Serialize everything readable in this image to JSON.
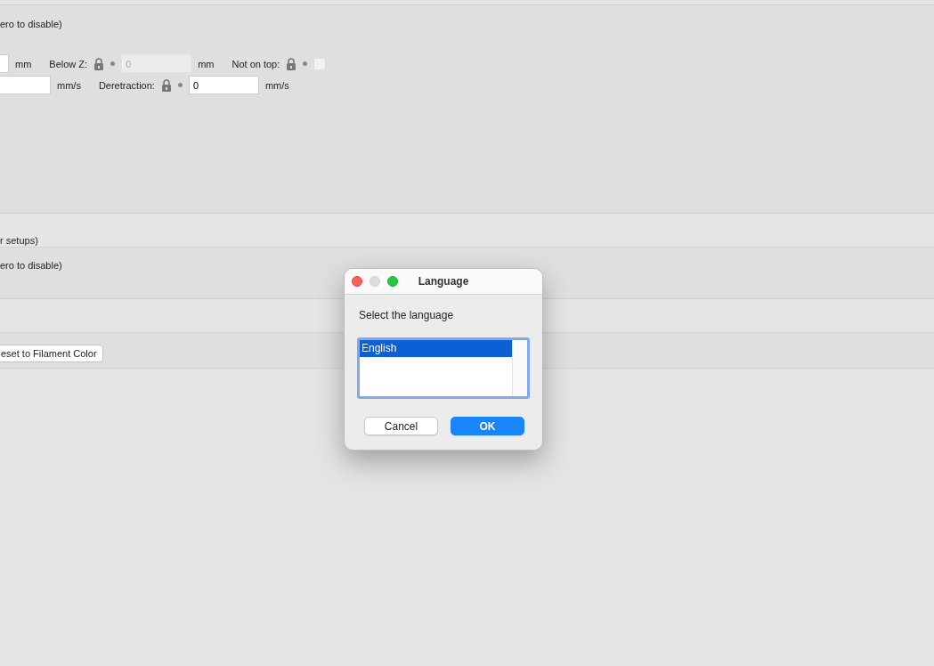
{
  "settings": {
    "sections": [
      {
        "kind": "options",
        "label": "ero to disable)",
        "rows": [
          {
            "fields": [
              {
                "kind": "input",
                "disabled": false,
                "unit": "mm"
              },
              {
                "kind": "input",
                "label": "Below Z:",
                "value": "0",
                "disabled": true,
                "unit": "mm"
              },
              {
                "kind": "checkbox",
                "label": "Not on top:",
                "checked": false,
                "disabled": true
              }
            ]
          },
          {
            "fields": [
              {
                "kind": "input",
                "disabled": false,
                "unit": "mm/s"
              },
              {
                "kind": "input",
                "label": "Deretraction:",
                "value": "0",
                "disabled": false,
                "unit": "mm/s"
              }
            ]
          }
        ]
      },
      {
        "kind": "label",
        "label": "r setups)"
      },
      {
        "kind": "label",
        "label": "ero to disable)"
      },
      {
        "kind": "blank"
      },
      {
        "kind": "button",
        "label": "eset to Filament Color"
      }
    ]
  },
  "dialog": {
    "title": "Language",
    "minimize_disabled": true,
    "prompt": "Select the language",
    "items": [
      {
        "label": "English",
        "selected": true
      }
    ],
    "buttons": [
      {
        "label": "Cancel",
        "default": false
      },
      {
        "label": "OK",
        "default": true
      }
    ]
  }
}
